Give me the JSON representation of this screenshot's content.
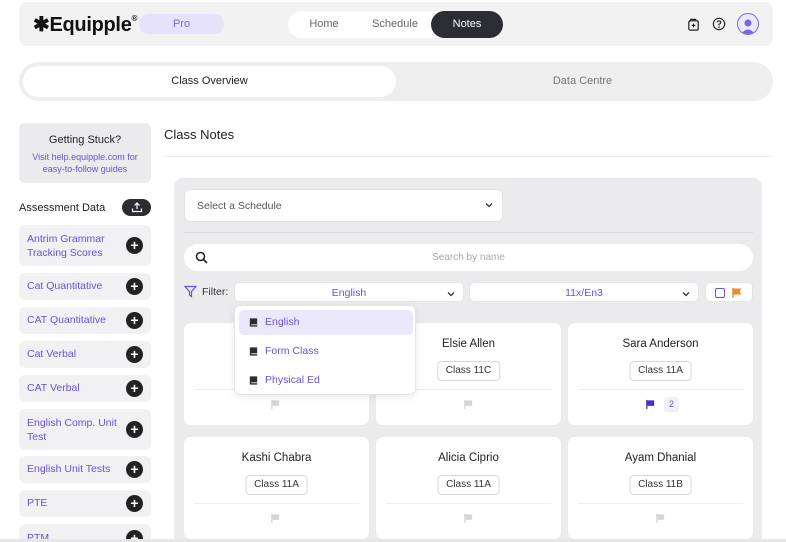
{
  "brand": {
    "name": "Equipple",
    "reg": "®",
    "plan": "Pro"
  },
  "nav": {
    "tabs": [
      "Home",
      "Schedule",
      "Notes"
    ],
    "active": "Notes"
  },
  "section_tabs": [
    "Class Overview",
    "Data Centre"
  ],
  "help": {
    "title": "Getting Stuck?",
    "text": "Visit help.equipple.com for easy-to-follow guides"
  },
  "assessment": {
    "title": "Assessment Data",
    "items": [
      "Antrim Grammar Tracking Scores",
      "Cat Quantitative",
      "CAT Quantitative",
      "Cat Verbal",
      "CAT Verbal",
      "English Comp. Unit Test",
      "English Unit Tests",
      "PTE",
      "PTM"
    ]
  },
  "main": {
    "title": "Class Notes",
    "schedule_placeholder": "Select a Schedule",
    "search_placeholder": "Search by name",
    "filter_label": "Filter:",
    "filter_subject": "English",
    "filter_class": "11x/En3"
  },
  "dropdown": {
    "options": [
      "English",
      "Form Class",
      "Physical Ed"
    ],
    "selected": "English"
  },
  "students": [
    {
      "name": "",
      "class": "",
      "flag": false
    },
    {
      "name": "Elsie Allen",
      "class": "Class 11C",
      "flag": false
    },
    {
      "name": "Sara Anderson",
      "class": "Class 11A",
      "flag": true,
      "count": "2"
    },
    {
      "name": "Kashi Chabra",
      "class": "Class 11A",
      "flag": false
    },
    {
      "name": "Alicia Ciprio",
      "class": "Class 11A",
      "flag": false
    },
    {
      "name": "Ayam Dhanial",
      "class": "Class 11B",
      "flag": false
    }
  ],
  "colors": {
    "accent": "#6c4fd6",
    "dark": "#2b2d33",
    "flag_orange": "#f08a24",
    "pill_bg": "#e6e2fb"
  }
}
